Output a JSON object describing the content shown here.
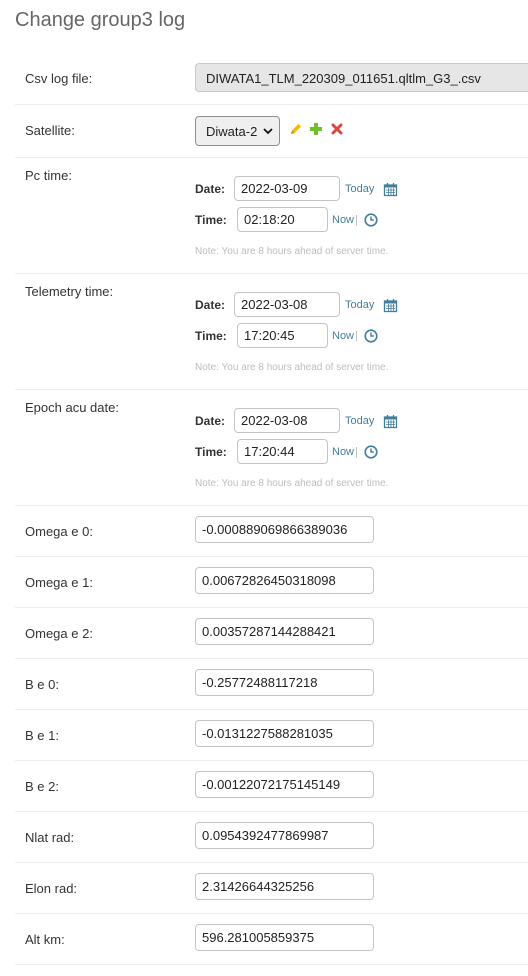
{
  "page": {
    "title": "Change group3 log"
  },
  "fields": {
    "csv": {
      "label": "Csv log file:",
      "value": "DIWATA1_TLM_220309_011651.qltlm_G3_.csv"
    },
    "satellite": {
      "label": "Satellite:",
      "value": "Diwata-2"
    },
    "pc_time": {
      "label": "Pc time:",
      "date": "2022-03-09",
      "time": "02:18:20"
    },
    "telemetry_time": {
      "label": "Telemetry time:",
      "date": "2022-03-08",
      "time": "17:20:45"
    },
    "epoch_acu_date": {
      "label": "Epoch acu date:",
      "date": "2022-03-08",
      "time": "17:20:44"
    },
    "omega_e_0": {
      "label": "Omega e 0:",
      "value": "-0.000889069866389036"
    },
    "omega_e_1": {
      "label": "Omega e 1:",
      "value": "0.00672826450318098"
    },
    "omega_e_2": {
      "label": "Omega e 2:",
      "value": "0.00357287144288421"
    },
    "b_e_0": {
      "label": "B e 0:",
      "value": "-0.25772488117218"
    },
    "b_e_1": {
      "label": "B e 1:",
      "value": "-0.0131227588281035"
    },
    "b_e_2": {
      "label": "B e 2:",
      "value": "-0.00122072175145149"
    },
    "nlat_rad": {
      "label": "Nlat rad:",
      "value": "0.0954392477869987"
    },
    "elon_rad": {
      "label": "Elon rad:",
      "value": "2.31426644325256"
    },
    "alt_km": {
      "label": "Alt km:",
      "value": "596.281005859375"
    }
  },
  "datetime_widget": {
    "date_label": "Date:",
    "time_label": "Time:",
    "today_link": "Today",
    "now_link": "Now",
    "separator": "|",
    "note": "Note: You are 8 hours ahead of server time."
  },
  "icons": {
    "edit": "pencil-icon",
    "add": "plus-icon",
    "delete": "x-icon",
    "calendar": "calendar-icon",
    "clock": "clock-icon"
  },
  "colors": {
    "link": "#447e9b",
    "edit": "#efb80b",
    "add": "#70bf2b",
    "delete": "#dd4646",
    "note": "#bdbdbd",
    "title": "#666666"
  }
}
